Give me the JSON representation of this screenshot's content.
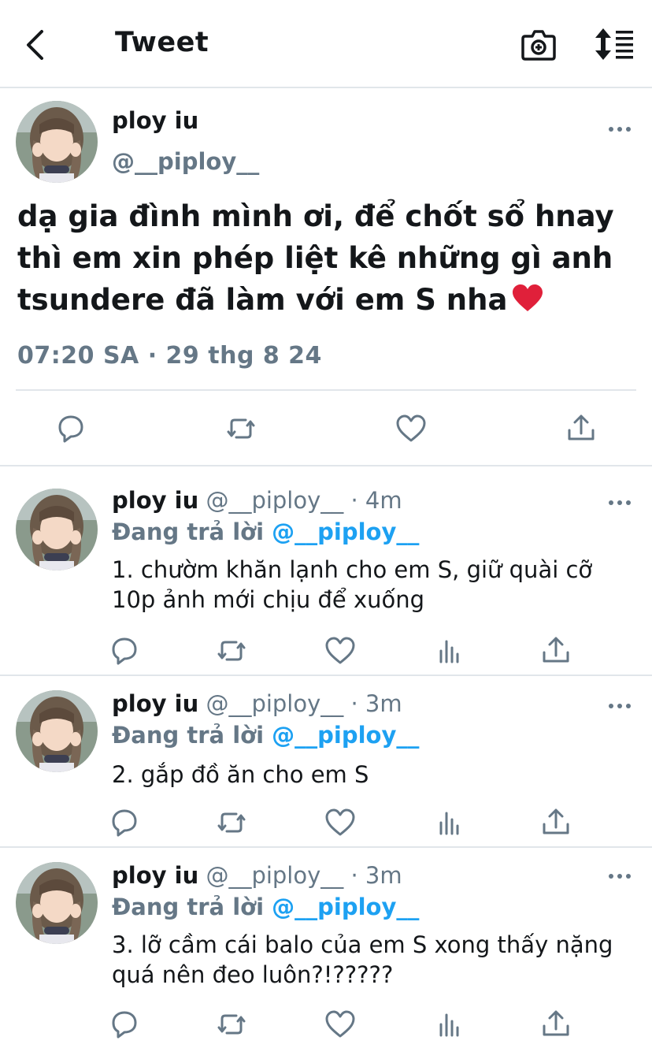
{
  "header": {
    "title": "Tweet"
  },
  "main_tweet": {
    "name": "ploy iu",
    "handle": "@__piploy__",
    "text": "dạ gia đình mình ơi, để chốt sổ hnay thì em xin phép liệt kê những gì anh tsundere đã làm với em S nha",
    "timestamp": "07:20 SA · 29 thg 8 24"
  },
  "replies": [
    {
      "name": "ploy iu",
      "meta": "@__piploy__ · 4m",
      "replying_label": "Đang trả lời",
      "replying_handle": "@__piploy__",
      "text": "1. chườm khăn lạnh cho em S, giữ quài cỡ 10p ảnh mới chịu để xuống"
    },
    {
      "name": "ploy iu",
      "meta": "@__piploy__ · 3m",
      "replying_label": "Đang trả lời",
      "replying_handle": "@__piploy__",
      "text": "2. gắp đồ ăn cho em S"
    },
    {
      "name": "ploy iu",
      "meta": "@__piploy__ · 3m",
      "replying_label": "Đang trả lời",
      "replying_handle": "@__piploy__",
      "text": "3. lỡ cầm cái balo của em S xong thấy nặng quá nên đeo luôn?!?????"
    }
  ],
  "icons": {
    "back": "chevron-left-icon",
    "camera": "camera-icon",
    "sort": "sort-icon",
    "more": "more-icon",
    "reply": "reply-icon",
    "retweet": "retweet-icon",
    "like": "heart-icon",
    "analytics": "analytics-icon",
    "share": "share-icon",
    "emoji": "red-heart-emoji"
  },
  "colors": {
    "accent": "#1da1f2",
    "text": "#14171a",
    "muted": "#657786",
    "divider": "#e1e6ea",
    "heart_emoji": "#e0203a"
  }
}
